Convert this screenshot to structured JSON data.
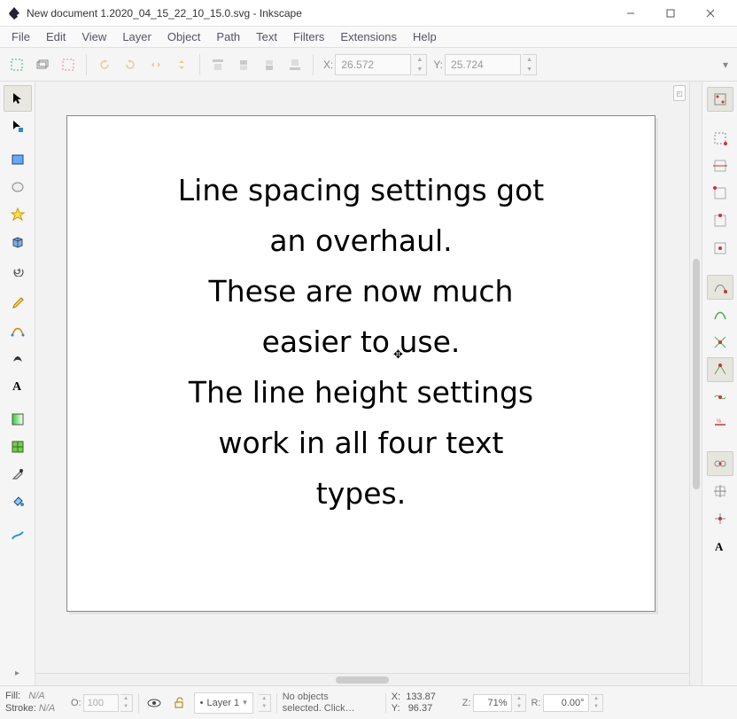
{
  "window": {
    "title": "New document 1.2020_04_15_22_10_15.0.svg - Inkscape"
  },
  "menu": [
    "File",
    "Edit",
    "View",
    "Layer",
    "Object",
    "Path",
    "Text",
    "Filters",
    "Extensions",
    "Help"
  ],
  "optionbar": {
    "x_label": "X:",
    "x_value": "26.572",
    "y_label": "Y:",
    "y_value": "25.724"
  },
  "canvas": {
    "text": "Line spacing settings got\nan overhaul.\nThese are now much\neasier to use.\nThe line height settings\nwork in all four text\ntypes."
  },
  "status": {
    "fill_label": "Fill:",
    "fill_value": "N/A",
    "stroke_label": "Stroke:",
    "stroke_value": "N/A",
    "opacity_label": "O:",
    "opacity_value": "100",
    "layer_prefix": "•",
    "layer_name": "Layer 1",
    "message": "No objects\nselected. Click…",
    "cx_label": "X:",
    "cx_value": "133.87",
    "cy_label": "Y:",
    "cy_value": "96.37",
    "zoom_label": "Z:",
    "zoom_value": "71%",
    "rot_label": "R:",
    "rot_value": "0.00°"
  }
}
